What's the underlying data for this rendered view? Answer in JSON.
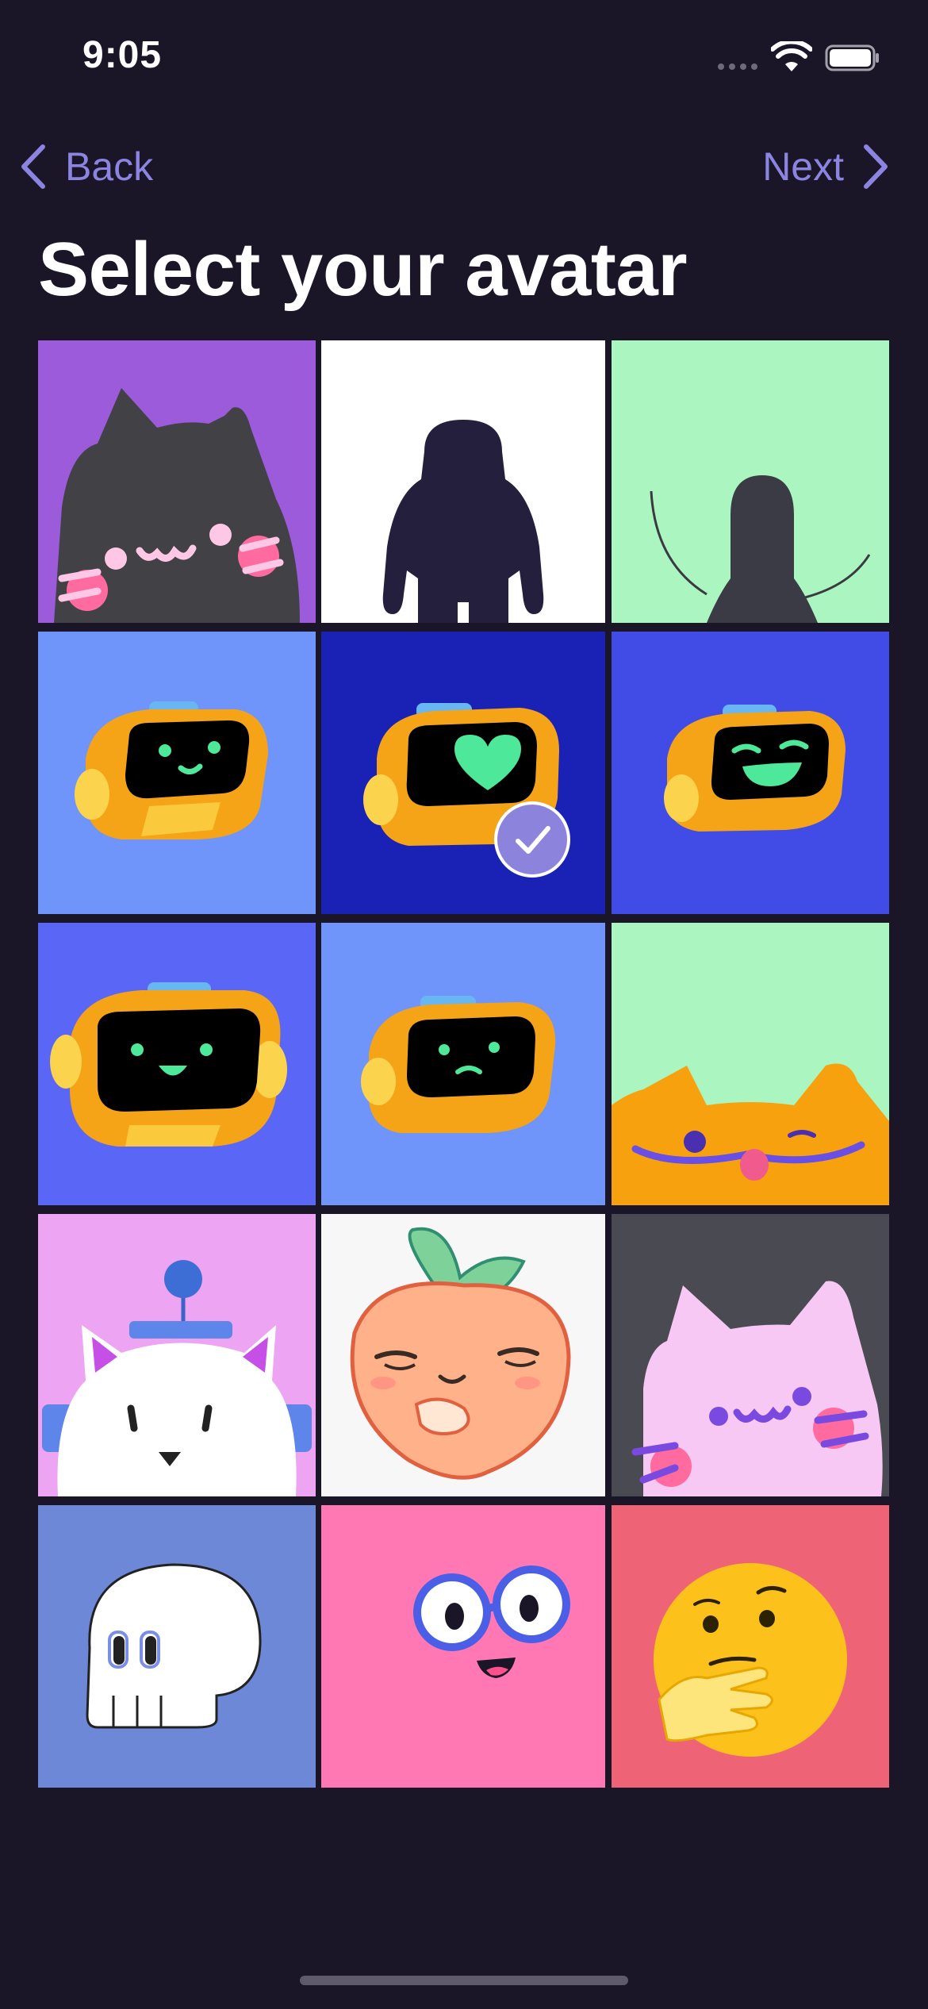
{
  "status_bar": {
    "time": "9:05"
  },
  "nav": {
    "back_label": "Back",
    "next_label": "Next"
  },
  "title": "Select your avatar",
  "grid": {
    "selected": "avatar-robot-heart",
    "tiles": [
      {
        "id": "avatar-cat-dark",
        "background": "#9b5bdb"
      },
      {
        "id": "avatar-silhouette-white",
        "background": "#ffffff"
      },
      {
        "id": "avatar-silhouette-green",
        "background": "#aaf5c0"
      },
      {
        "id": "avatar-robot-smile",
        "background": "#6f95fa"
      },
      {
        "id": "avatar-robot-heart",
        "background": "#1a22b5"
      },
      {
        "id": "avatar-robot-laugh",
        "background": "#414ce7"
      },
      {
        "id": "avatar-robot-happy",
        "background": "#5a66f5"
      },
      {
        "id": "avatar-robot-worried",
        "background": "#6f95fa"
      },
      {
        "id": "avatar-orange-cat",
        "background": "#aaf5c0"
      },
      {
        "id": "avatar-white-cat-robot",
        "background": "#eca4f3"
      },
      {
        "id": "avatar-peach",
        "background": "#f7f7f7"
      },
      {
        "id": "avatar-pink-cat",
        "background": "#4a4a52"
      },
      {
        "id": "avatar-skull",
        "background": "#6e88d8"
      },
      {
        "id": "avatar-glasses-face",
        "background": "#ff78b4"
      },
      {
        "id": "avatar-thinking-emoji",
        "background": "#ee6476"
      }
    ]
  },
  "colors": {
    "background": "#1a1628",
    "accent": "#8b84e0",
    "title": "#ffffff",
    "check_badge": "#8c84dc"
  },
  "icons": [
    "wifi-icon",
    "battery-icon",
    "chevron-left-icon",
    "chevron-right-icon",
    "checkmark-icon"
  ]
}
